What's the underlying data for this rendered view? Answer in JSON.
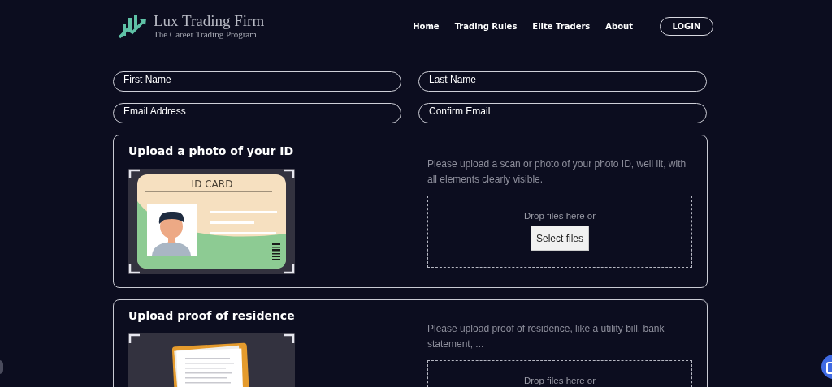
{
  "brand": {
    "name": "Lux Trading Firm",
    "tagline": "The Career Trading Program"
  },
  "nav": [
    {
      "label": "Home"
    },
    {
      "label": "Trading Rules"
    },
    {
      "label": "Elite Traders"
    },
    {
      "label": "About"
    }
  ],
  "login": "LOGIN",
  "fields": [
    {
      "placeholder": "First Name"
    },
    {
      "placeholder": "Last Name"
    },
    {
      "placeholder": "Email Address"
    },
    {
      "placeholder": "Confirm Email"
    }
  ],
  "uploads": [
    {
      "title": "Upload a photo of your ID",
      "kind": "id-card",
      "card_label": "ID CARD",
      "hint": "Please upload a scan or photo of your photo ID, well lit, with all elements clearly visible.",
      "drop_text": "Drop files here or",
      "button": "Select files"
    },
    {
      "title": "Upload proof of residence",
      "kind": "document",
      "hint": "Please upload proof of residence, like a utility bill, bank statement, ...",
      "drop_text": "Drop files here or"
    }
  ]
}
